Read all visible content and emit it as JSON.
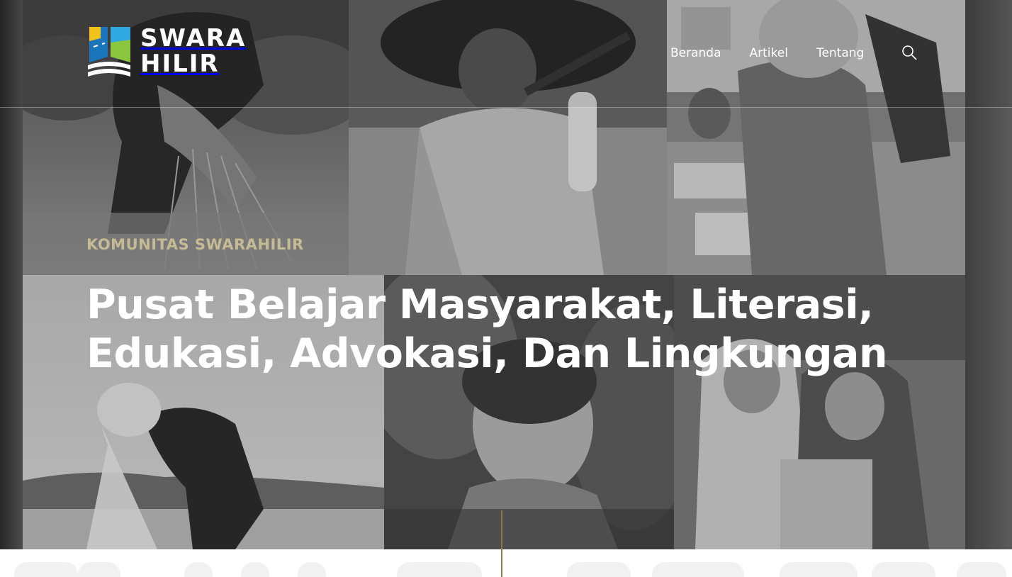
{
  "site": {
    "logo_line1": "SWARA",
    "logo_line2": "HILIR",
    "logo_colors": [
      "#f2c21b",
      "#2fa9e0",
      "#8cc63f",
      "#1b75bb"
    ]
  },
  "nav": {
    "items": [
      {
        "label": "Beranda"
      },
      {
        "label": "Artikel"
      },
      {
        "label": "Tentang"
      }
    ],
    "search_icon": "search-icon"
  },
  "hero": {
    "eyebrow": "KOMUNITAS SWARAHILIR",
    "headline": "Pusat Belajar Masyarakat, Literasi, Edukasi, Advokasi, Dan Lingkungan",
    "accent_color": "#d2c79a"
  }
}
